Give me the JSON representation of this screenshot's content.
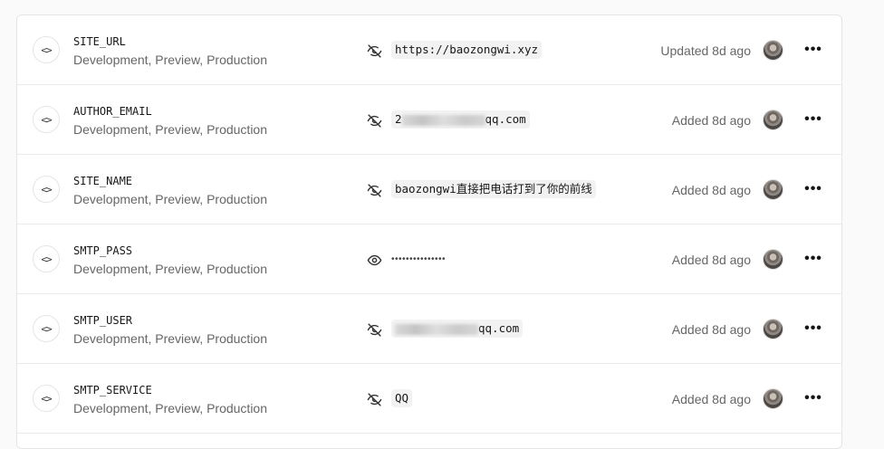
{
  "rows": [
    {
      "name": "SITE_URL",
      "targets": "Development, Preview, Production",
      "visibility_icon": "eye-off-icon",
      "value": "https://baozongwi.xyz",
      "value_prefix": "",
      "value_suffix": "",
      "status": "Updated 8d ago"
    },
    {
      "name": "AUTHOR_EMAIL",
      "targets": "Development, Preview, Production",
      "visibility_icon": "eye-off-icon",
      "value": "",
      "value_prefix": "2",
      "value_suffix": "qq.com",
      "status": "Added 8d ago"
    },
    {
      "name": "SITE_NAME",
      "targets": "Development, Preview, Production",
      "visibility_icon": "eye-off-icon",
      "value": "baozongwi直接把电话打到了你的前线",
      "value_prefix": "",
      "value_suffix": "",
      "status": "Added 8d ago"
    },
    {
      "name": "SMTP_PASS",
      "targets": "Development, Preview, Production",
      "visibility_icon": "eye-icon",
      "value": "•••••••••••••••",
      "value_prefix": "",
      "value_suffix": "",
      "status": "Added 8d ago"
    },
    {
      "name": "SMTP_USER",
      "targets": "Development, Preview, Production",
      "visibility_icon": "eye-off-icon",
      "value": "",
      "value_prefix": "",
      "value_suffix": "qq.com",
      "status": "Added 8d ago"
    },
    {
      "name": "SMTP_SERVICE",
      "targets": "Development, Preview, Production",
      "visibility_icon": "eye-off-icon",
      "value": "QQ",
      "value_prefix": "",
      "value_suffix": "",
      "status": "Added 8d ago"
    }
  ],
  "icons": {
    "row_type": "code-icon",
    "actions": "more-horizontal-icon",
    "avatar": "user-avatar"
  },
  "colors": {
    "border": "#e5e5e5",
    "muted_text": "#666666",
    "chip_bg": "#f2f2f2"
  }
}
